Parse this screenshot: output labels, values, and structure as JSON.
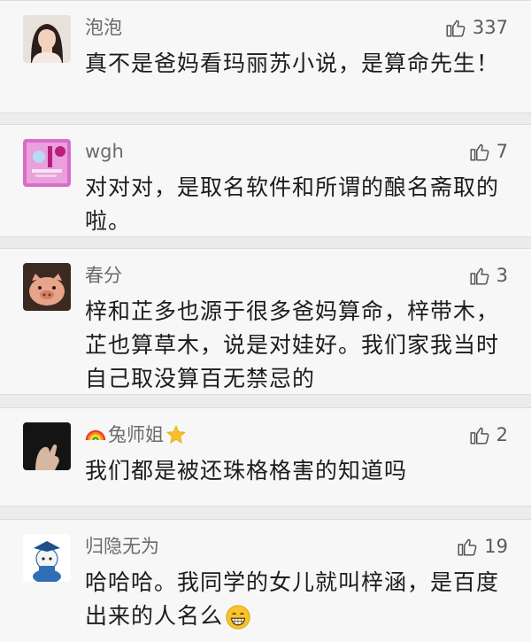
{
  "comments": [
    {
      "name": "泡泡",
      "likes": "337",
      "text": "真不是爸妈看玛丽苏小说，是算命先生！"
    },
    {
      "name": "wgh",
      "likes": "7",
      "text": "对对对，是取名软件和所谓的酿名斋取的啦。"
    },
    {
      "name": "春分",
      "likes": "3",
      "text": "梓和芷多也源于很多爸妈算命，梓带木，芷也算草木，说是对娃好。我们家我当时自己取没算百无禁忌的"
    },
    {
      "name": "兔师姐",
      "likes": "2",
      "text": "我们都是被还珠格格害的知道吗"
    },
    {
      "name": "归隐无为",
      "likes": "19",
      "text": "哈哈哈。我同学的女儿就叫梓涵，是百度出来的人名么"
    }
  ],
  "icons": {
    "like": "thumbs-up-icon",
    "rainbow": "rainbow-icon",
    "star": "star-icon",
    "grin": "grinning-face-icon"
  }
}
